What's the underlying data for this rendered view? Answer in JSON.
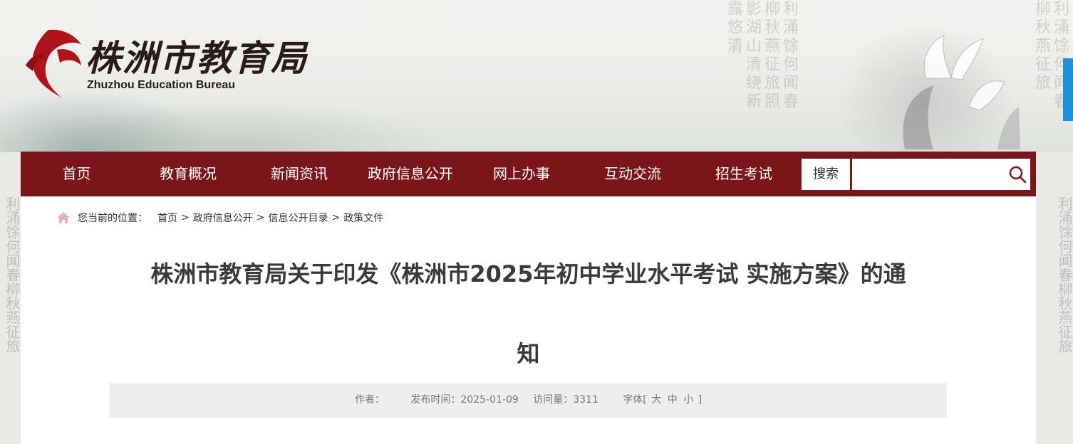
{
  "header": {
    "logo_cn": "株洲市教育局",
    "logo_en": "Zhuzhou Education Bureau",
    "background_text_a": "利涌馀何闻春柳秋燕征旅照影湖山清绕新露悠清",
    "background_text_b": "利涌馀何闻春柳秋燕征旅"
  },
  "nav": {
    "items": [
      "首页",
      "教育概况",
      "新闻资讯",
      "政府信息公开",
      "网上办事",
      "互动交流",
      "招生考试"
    ],
    "search_label": "搜索",
    "search_value": ""
  },
  "breadcrumb": {
    "prefix": "您当前的位置：",
    "items": [
      "首页",
      "政府信息公开",
      "信息公开目录",
      "政策文件"
    ],
    "separator": ">"
  },
  "article": {
    "title_line1": "株洲市教育局关于印发《株洲市2025年初中学业水平考试 实施方案》的通",
    "title_line2": "知",
    "author_label": "作者：",
    "author": "",
    "date_label": "发布时间：",
    "date": "2025-01-09",
    "views_label": "访问量：",
    "views": "3311",
    "font_label": "字体[",
    "font_large": "大",
    "font_medium": "中",
    "font_small": "小",
    "font_close": "]"
  },
  "colors": {
    "nav_bg": "#7a1519",
    "logo_red": "#b01319",
    "side_tab": "#1e8fd8"
  }
}
